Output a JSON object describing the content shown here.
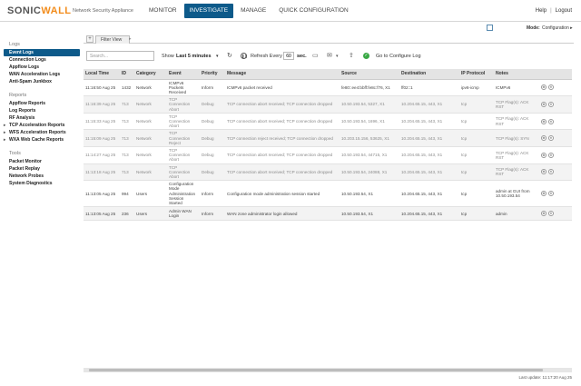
{
  "brand": {
    "logo_main": "SONIC",
    "logo_accent": "WALL",
    "product": "Network Security Appliance"
  },
  "nav": {
    "items": [
      "MONITOR",
      "INVESTIGATE",
      "MANAGE",
      "QUICK CONFIGURATION"
    ],
    "active": "INVESTIGATE"
  },
  "top_right": {
    "help": "Help",
    "separator": "|",
    "logout": "Logout"
  },
  "mode": {
    "label": "Mode:",
    "value": "Configuration ▸"
  },
  "sidebar": {
    "sections": [
      {
        "title": "Logs",
        "items": [
          "Event Logs",
          "Connection Logs",
          "Appflow Logs",
          "WAN Acceleration Logs",
          "Anti-Spam Junkbox"
        ]
      },
      {
        "title": "Reports",
        "items": [
          "Appflow Reports",
          "Log Reports",
          "RF Analysis",
          "TCP Acceleration Reports",
          "WFS Acceleration Reports",
          "WXA Web Cache Reports"
        ]
      },
      {
        "title": "Tools",
        "items": [
          "Packet Monitor",
          "Packet Replay",
          "Network Probes",
          "System Diagnostics"
        ]
      }
    ],
    "active_item": "Event Logs"
  },
  "tabs": {
    "add_label": "+",
    "filter_view": "Filter View",
    "arrow": "▸"
  },
  "toolbar": {
    "search_placeholder": "Search...",
    "show_label": "Show",
    "period": "Last 5 minutes",
    "period_caret": "▾",
    "refresh_every": "Refresh Every",
    "interval": "60",
    "sec": "sec.",
    "go_configure": "Go to Configure Log",
    "icons": [
      "refresh-icon",
      "pause-icon",
      "monitor-icon",
      "email-icon",
      "export-icon",
      "check-icon"
    ]
  },
  "table": {
    "columns": [
      "Local Time",
      "ID",
      "Category",
      "Event",
      "Priority",
      "Message",
      "Source",
      "Destination",
      "IP Protocol",
      "Notes",
      ""
    ],
    "rows": [
      {
        "time": "11:16:50 Aug 25",
        "id": "1432",
        "category": "Network",
        "event": "ICMPv6 Packets Received",
        "priority": "Inform",
        "message": "ICMPv6 packet received",
        "source": "fe80::ee4:bbff:fe8c:f76, X1",
        "destination": "ff02::1",
        "protocol": "ipv6-icmp",
        "notes": "ICMPv6",
        "muted": false
      },
      {
        "time": "11:16:39 Aug 25",
        "id": "713",
        "category": "Network",
        "event": "TCP Connection Abort",
        "priority": "Debug",
        "message": "TCP connection abort received; TCP connection dropped",
        "source": "10.50.193.54, 5327, X1",
        "destination": "10.204.65.15, 443, X1",
        "protocol": "tcp",
        "notes": "TCP Flag(s): ACK RST",
        "muted": true
      },
      {
        "time": "11:15:33 Aug 25",
        "id": "713",
        "category": "Network",
        "event": "TCP Connection Abort",
        "priority": "Debug",
        "message": "TCP connection abort received; TCP connection dropped",
        "source": "10.50.193.54, 1696, X1",
        "destination": "10.204.65.15, 443, X1",
        "protocol": "tcp",
        "notes": "TCP Flag(s): ACK RST",
        "muted": true
      },
      {
        "time": "11:15:09 Aug 25",
        "id": "713",
        "category": "Network",
        "event": "TCP Connection Reject",
        "priority": "Debug",
        "message": "TCP connection reject received; TCP connection dropped",
        "source": "10.203.15.156, 53625, X1",
        "destination": "10.204.65.15, 443, X1",
        "protocol": "tcp",
        "notes": "TCP Flag(s): SYN",
        "muted": true
      },
      {
        "time": "11:14:27 Aug 25",
        "id": "713",
        "category": "Network",
        "event": "TCP Connection Abort",
        "priority": "Debug",
        "message": "TCP connection abort received; TCP connection dropped",
        "source": "10.50.193.54, 44715, X1",
        "destination": "10.204.65.15, 443, X1",
        "protocol": "tcp",
        "notes": "TCP Flag(s): ACK RST",
        "muted": true
      },
      {
        "time": "11:13:18 Aug 25",
        "id": "713",
        "category": "Network",
        "event": "TCP Connection Abort",
        "priority": "Debug",
        "message": "TCP connection abort received; TCP connection dropped",
        "source": "10.50.193.54, 24088, X1",
        "destination": "10.204.65.15, 443, X1",
        "protocol": "tcp",
        "notes": "TCP Flag(s): ACK RST",
        "muted": true
      },
      {
        "time": "11:13:05 Aug 25",
        "id": "994",
        "category": "Users",
        "event": "Configuration Mode Administration Session Started",
        "priority": "Inform",
        "message": "Configuration mode administration session started",
        "source": "10.50.193.54, X1",
        "destination": "10.204.65.15, 443, X1",
        "protocol": "tcp",
        "notes": "admin at GUI from 10.50.193.54",
        "muted": false
      },
      {
        "time": "11:13:05 Aug 25",
        "id": "236",
        "category": "Users",
        "event": "Admin WAN Login",
        "priority": "Inform",
        "message": "WAN zone administrator login allowed",
        "source": "10.50.193.54, X1",
        "destination": "10.204.65.15, 443, X1",
        "protocol": "tcp",
        "notes": "admin",
        "muted": false
      }
    ]
  },
  "footer": {
    "last_update": "Last update: 11:17:20 Aug 25"
  },
  "colors": {
    "accent": "#0d5a8a",
    "logo_accent": "#f28c1c",
    "check": "#39a845"
  }
}
